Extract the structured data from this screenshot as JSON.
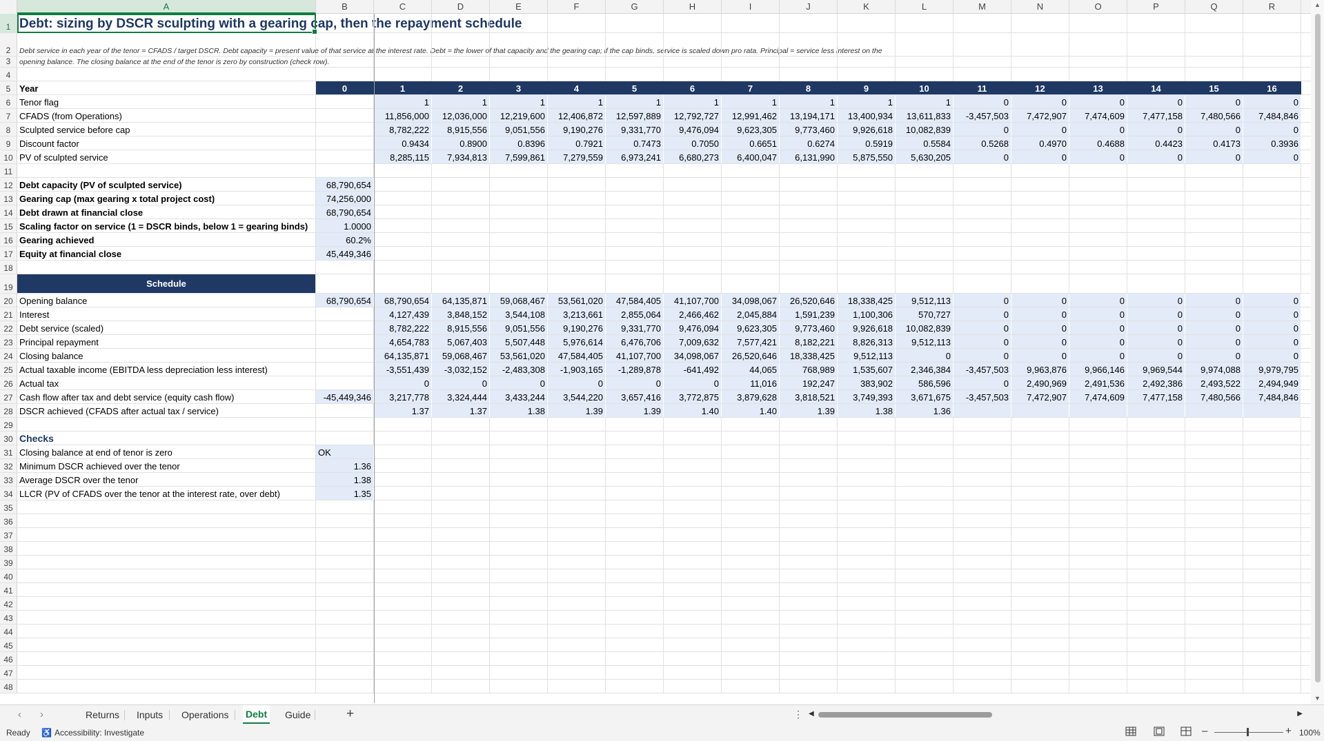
{
  "columns": [
    "A",
    "B",
    "C",
    "D",
    "E",
    "F",
    "G",
    "H",
    "I",
    "J",
    "K",
    "L",
    "M",
    "N",
    "O",
    "P",
    "Q",
    "R"
  ],
  "title": "Debt: sizing by DSCR sculpting with a gearing cap, then the repayment schedule",
  "description_line1": "Debt service in each year of the tenor = CFADS / target DSCR. Debt capacity = present value of that service at the interest rate. Debt = the lower of that capacity and the gearing cap; if the cap binds, service is scaled down pro rata. Principal = service less interest on the",
  "description_line2": "opening balance. The closing balance at the end of the tenor is zero by construction (check row).",
  "year_row": {
    "label": "Year",
    "values": [
      "0",
      "1",
      "2",
      "3",
      "4",
      "5",
      "6",
      "7",
      "8",
      "9",
      "10",
      "11",
      "12",
      "13",
      "14",
      "15",
      "16"
    ]
  },
  "top_rows": [
    {
      "n": "6",
      "label": "Tenor flag",
      "b": "",
      "values": [
        "1",
        "1",
        "1",
        "1",
        "1",
        "1",
        "1",
        "1",
        "1",
        "1",
        "0",
        "0",
        "0",
        "0",
        "0",
        "0"
      ]
    },
    {
      "n": "7",
      "label": "CFADS (from Operations)",
      "b": "",
      "values": [
        "11,856,000",
        "12,036,000",
        "12,219,600",
        "12,406,872",
        "12,597,889",
        "12,792,727",
        "12,991,462",
        "13,194,171",
        "13,400,934",
        "13,611,833",
        "-3,457,503",
        "7,472,907",
        "7,474,609",
        "7,477,158",
        "7,480,566",
        "7,484,846"
      ]
    },
    {
      "n": "8",
      "label": "Sculpted service before cap",
      "b": "",
      "values": [
        "8,782,222",
        "8,915,556",
        "9,051,556",
        "9,190,276",
        "9,331,770",
        "9,476,094",
        "9,623,305",
        "9,773,460",
        "9,926,618",
        "10,082,839",
        "0",
        "0",
        "0",
        "0",
        "0",
        "0"
      ]
    },
    {
      "n": "9",
      "label": "Discount factor",
      "b": "",
      "values": [
        "0.9434",
        "0.8900",
        "0.8396",
        "0.7921",
        "0.7473",
        "0.7050",
        "0.6651",
        "0.6274",
        "0.5919",
        "0.5584",
        "0.5268",
        "0.4970",
        "0.4688",
        "0.4423",
        "0.4173",
        "0.3936"
      ]
    },
    {
      "n": "10",
      "label": "PV of sculpted service",
      "b": "",
      "values": [
        "8,285,115",
        "7,934,813",
        "7,599,861",
        "7,279,559",
        "6,973,241",
        "6,680,273",
        "6,400,047",
        "6,131,990",
        "5,875,550",
        "5,630,205",
        "0",
        "0",
        "0",
        "0",
        "0",
        "0"
      ]
    }
  ],
  "summary_rows": [
    {
      "n": "12",
      "label": "Debt capacity (PV of sculpted service)",
      "value": "68,790,654"
    },
    {
      "n": "13",
      "label": "Gearing cap (max gearing x total project cost)",
      "value": "74,256,000"
    },
    {
      "n": "14",
      "label": "Debt drawn at financial close",
      "value": "68,790,654"
    },
    {
      "n": "15",
      "label": "Scaling factor on service (1 = DSCR binds, below 1 = gearing binds)",
      "value": "1.0000"
    },
    {
      "n": "16",
      "label": "Gearing achieved",
      "value": "60.2%"
    },
    {
      "n": "17",
      "label": "Equity at financial close",
      "value": "45,449,346"
    }
  ],
  "schedule_header": "Schedule",
  "schedule_rows": [
    {
      "n": "20",
      "label": "Opening balance",
      "b": "68,790,654",
      "values": [
        "68,790,654",
        "64,135,871",
        "59,068,467",
        "53,561,020",
        "47,584,405",
        "41,107,700",
        "34,098,067",
        "26,520,646",
        "18,338,425",
        "9,512,113",
        "0",
        "0",
        "0",
        "0",
        "0",
        "0"
      ]
    },
    {
      "n": "21",
      "label": "Interest",
      "b": "",
      "values": [
        "4,127,439",
        "3,848,152",
        "3,544,108",
        "3,213,661",
        "2,855,064",
        "2,466,462",
        "2,045,884",
        "1,591,239",
        "1,100,306",
        "570,727",
        "0",
        "0",
        "0",
        "0",
        "0",
        "0"
      ]
    },
    {
      "n": "22",
      "label": "Debt service (scaled)",
      "b": "",
      "values": [
        "8,782,222",
        "8,915,556",
        "9,051,556",
        "9,190,276",
        "9,331,770",
        "9,476,094",
        "9,623,305",
        "9,773,460",
        "9,926,618",
        "10,082,839",
        "0",
        "0",
        "0",
        "0",
        "0",
        "0"
      ]
    },
    {
      "n": "23",
      "label": "Principal repayment",
      "b": "",
      "values": [
        "4,654,783",
        "5,067,403",
        "5,507,448",
        "5,976,614",
        "6,476,706",
        "7,009,632",
        "7,577,421",
        "8,182,221",
        "8,826,313",
        "9,512,113",
        "0",
        "0",
        "0",
        "0",
        "0",
        "0"
      ]
    },
    {
      "n": "24",
      "label": "Closing balance",
      "b": "",
      "values": [
        "64,135,871",
        "59,068,467",
        "53,561,020",
        "47,584,405",
        "41,107,700",
        "34,098,067",
        "26,520,646",
        "18,338,425",
        "9,512,113",
        "0",
        "0",
        "0",
        "0",
        "0",
        "0",
        "0"
      ]
    },
    {
      "n": "25",
      "label": "Actual taxable income (EBITDA less depreciation less interest)",
      "b": "",
      "values": [
        "-3,551,439",
        "-3,032,152",
        "-2,483,308",
        "-1,903,165",
        "-1,289,878",
        "-641,492",
        "44,065",
        "768,989",
        "1,535,607",
        "2,346,384",
        "-3,457,503",
        "9,963,876",
        "9,966,146",
        "9,969,544",
        "9,974,088",
        "9,979,795"
      ]
    },
    {
      "n": "26",
      "label": "Actual tax",
      "b": "",
      "values": [
        "0",
        "0",
        "0",
        "0",
        "0",
        "0",
        "11,016",
        "192,247",
        "383,902",
        "586,596",
        "0",
        "2,490,969",
        "2,491,536",
        "2,492,386",
        "2,493,522",
        "2,494,949"
      ]
    },
    {
      "n": "27",
      "label": "Cash flow after tax and debt service (equity cash flow)",
      "b": "-45,449,346",
      "values": [
        "3,217,778",
        "3,324,444",
        "3,433,244",
        "3,544,220",
        "3,657,416",
        "3,772,875",
        "3,879,628",
        "3,818,521",
        "3,749,393",
        "3,671,675",
        "-3,457,503",
        "7,472,907",
        "7,474,609",
        "7,477,158",
        "7,480,566",
        "7,484,846"
      ]
    },
    {
      "n": "28",
      "label": "DSCR achieved (CFADS after actual tax / service)",
      "b": "",
      "values": [
        "1.37",
        "1.37",
        "1.38",
        "1.39",
        "1.39",
        "1.40",
        "1.40",
        "1.39",
        "1.38",
        "1.36",
        "",
        "",
        "",
        "",
        "",
        ""
      ]
    }
  ],
  "checks_title": "Checks",
  "check_rows": [
    {
      "n": "31",
      "label": "Closing balance at end of tenor is zero",
      "value": "OK",
      "align": "left"
    },
    {
      "n": "32",
      "label": "Minimum DSCR achieved over the tenor",
      "value": "1.36",
      "align": "right"
    },
    {
      "n": "33",
      "label": "Average DSCR over the tenor",
      "value": "1.38",
      "align": "right"
    },
    {
      "n": "34",
      "label": "LLCR (PV of CFADS over the tenor at the interest rate, over debt)",
      "value": "1.35",
      "align": "right"
    }
  ],
  "sheet_tabs": [
    "Returns",
    "Inputs",
    "Operations",
    "Debt",
    "Guide"
  ],
  "active_tab": "Debt",
  "status": {
    "ready": "Ready",
    "accessibility": "Accessibility: Investigate",
    "zoom": "100%"
  }
}
